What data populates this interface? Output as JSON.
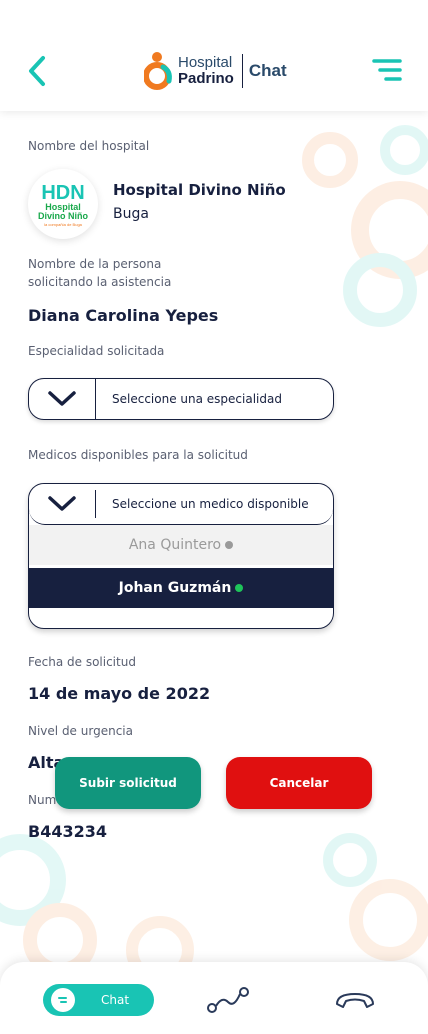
{
  "header": {
    "brand_top": "Hospital",
    "brand_bottom": "Padrino",
    "section": "Chat"
  },
  "hospital": {
    "label": "Nombre del hospital",
    "logo_text_top": "HDN",
    "logo_text_mid1": "Hospital",
    "logo_text_mid2": "Divino Niño",
    "logo_text_bot": "la compañía de Buga",
    "name": "Hospital Divino Niño",
    "city": "Buga"
  },
  "requester": {
    "label_line1": "Nombre de la persona",
    "label_line2": "solicitando la asistencia",
    "name": "Diana Carolina Yepes"
  },
  "specialty": {
    "label": "Especialidad solicitada",
    "placeholder": "Seleccione una especialidad"
  },
  "doctors": {
    "label": "Medicos disponibles para la solicitud",
    "placeholder": "Seleccione un medico disponible",
    "options": [
      {
        "name": "Ana Quintero",
        "status_color": "#9a9a9a"
      },
      {
        "name": "Johan Guzmán",
        "status_color": "#1ec45a"
      }
    ]
  },
  "date": {
    "label": "Fecha de solicitud",
    "value": "14 de mayo de 2022"
  },
  "urgency": {
    "label": "Nivel de urgencia",
    "value": "Alta"
  },
  "number": {
    "label": "Numero de solicitud",
    "value": "B443234"
  },
  "actions": {
    "upload_label": "Subir solicitud",
    "cancel_label": "Cancelar"
  },
  "tabbar": {
    "chat_label": "Chat",
    "icons": [
      "chat-icon",
      "route-icon",
      "hang-up-icon"
    ]
  },
  "colors": {
    "navy": "#17203f",
    "teal": "#19c4b4",
    "green": "#11967d",
    "red": "#e01010",
    "orange": "#f07a20"
  }
}
